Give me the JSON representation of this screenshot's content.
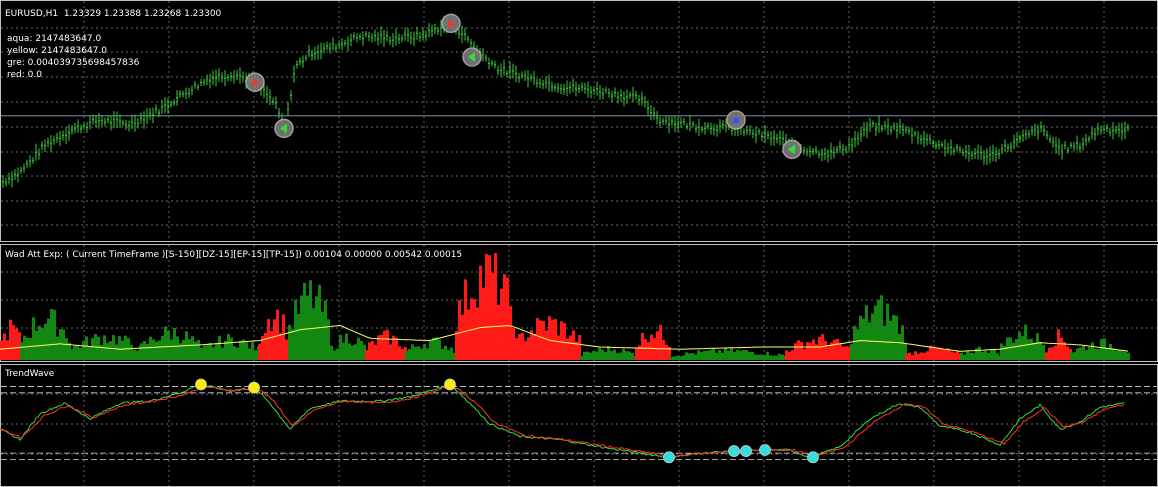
{
  "colors": {
    "background": "#000000",
    "grid": "#8a8a8a",
    "pane_border": "#c0c0c0",
    "candle": "#33cc33",
    "hline": "#9aa0c8",
    "hist_up": "#128712",
    "hist_down": "#ff1a1a",
    "signal_line": "#ffff66",
    "wave_green": "#33dd33",
    "wave_red": "#ff3030",
    "dot_yellow": "#ffee00",
    "dot_aqua": "#33dddd"
  },
  "main_pane": {
    "title": "EURUSD,H1  1.23329 1.23388 1.23268 1.23300",
    "info_lines": [
      "aqua: 2147483647.0",
      "yellow: 2147483647.0",
      "gre: 0.004039735698457836",
      "red: 0.0"
    ]
  },
  "wad_pane": {
    "title": "Wad Att Exp: ( Current TimeFrame )[S-150][DZ-15][EP-15][TP-15]) 0.00104 0.00000 0.00542 0.00015"
  },
  "wave_pane": {
    "title": "TrendWave"
  },
  "chart_data": [
    {
      "type": "candlestick",
      "symbol": "EURUSD",
      "timeframe": "H1",
      "title": "EURUSD,H1  1.23329 1.23388 1.23268 1.23300",
      "close_trace_normalized": [
        [
          0,
          0.2
        ],
        [
          20,
          0.25
        ],
        [
          45,
          0.38
        ],
        [
          70,
          0.45
        ],
        [
          100,
          0.5
        ],
        [
          130,
          0.48
        ],
        [
          160,
          0.55
        ],
        [
          185,
          0.63
        ],
        [
          210,
          0.7
        ],
        [
          235,
          0.72
        ],
        [
          255,
          0.68
        ],
        [
          275,
          0.58
        ],
        [
          285,
          0.45
        ],
        [
          295,
          0.75
        ],
        [
          310,
          0.82
        ],
        [
          340,
          0.86
        ],
        [
          360,
          0.9
        ],
        [
          390,
          0.89
        ],
        [
          420,
          0.9
        ],
        [
          450,
          0.96
        ],
        [
          465,
          0.9
        ],
        [
          480,
          0.82
        ],
        [
          500,
          0.74
        ],
        [
          530,
          0.7
        ],
        [
          560,
          0.66
        ],
        [
          600,
          0.64
        ],
        [
          640,
          0.6
        ],
        [
          660,
          0.5
        ],
        [
          700,
          0.47
        ],
        [
          735,
          0.46
        ],
        [
          760,
          0.43
        ],
        [
          785,
          0.4
        ],
        [
          805,
          0.36
        ],
        [
          830,
          0.34
        ],
        [
          850,
          0.38
        ],
        [
          870,
          0.47
        ],
        [
          900,
          0.46
        ],
        [
          930,
          0.4
        ],
        [
          960,
          0.35
        ],
        [
          990,
          0.33
        ],
        [
          1010,
          0.38
        ],
        [
          1040,
          0.46
        ],
        [
          1060,
          0.36
        ],
        [
          1080,
          0.38
        ],
        [
          1100,
          0.46
        ],
        [
          1130,
          0.45
        ]
      ],
      "signals": [
        {
          "x": 255,
          "y": 0.68,
          "dir": "up",
          "color": "#ff3030"
        },
        {
          "x": 284,
          "y": 0.46,
          "dir": "left",
          "color": "#33dd33"
        },
        {
          "x": 451,
          "y": 0.96,
          "dir": "up",
          "color": "#ff3030"
        },
        {
          "x": 472,
          "y": 0.8,
          "dir": "left",
          "color": "#33dd33"
        },
        {
          "x": 736,
          "y": 0.5,
          "dir": "up",
          "color": "#3050ff"
        },
        {
          "x": 792,
          "y": 0.36,
          "dir": "left",
          "color": "#33dd33"
        }
      ],
      "hline_level": 0.52
    },
    {
      "type": "bar",
      "title": "Wad Att Exp: ( Current TimeFrame )[S-150][DZ-15][EP-15][TP-15]) 0.00104 0.00000 0.00542 0.00015",
      "segments": [
        {
          "from": 0,
          "to": 20,
          "color": "down",
          "peak": 0.35
        },
        {
          "from": 20,
          "to": 70,
          "color": "up",
          "peak": 0.45
        },
        {
          "from": 70,
          "to": 140,
          "color": "up",
          "peak": 0.25
        },
        {
          "from": 140,
          "to": 200,
          "color": "up",
          "peak": 0.3
        },
        {
          "from": 200,
          "to": 258,
          "color": "up",
          "peak": 0.22
        },
        {
          "from": 258,
          "to": 288,
          "color": "down",
          "peak": 0.5
        },
        {
          "from": 288,
          "to": 330,
          "color": "up",
          "peak": 0.7
        },
        {
          "from": 330,
          "to": 365,
          "color": "up",
          "peak": 0.25
        },
        {
          "from": 365,
          "to": 405,
          "color": "down",
          "peak": 0.25
        },
        {
          "from": 405,
          "to": 455,
          "color": "up",
          "peak": 0.2
        },
        {
          "from": 455,
          "to": 515,
          "color": "down",
          "peak": 0.95
        },
        {
          "from": 515,
          "to": 580,
          "color": "down",
          "peak": 0.4
        },
        {
          "from": 580,
          "to": 635,
          "color": "up",
          "peak": 0.12
        },
        {
          "from": 635,
          "to": 670,
          "color": "down",
          "peak": 0.32
        },
        {
          "from": 670,
          "to": 785,
          "color": "up",
          "peak": 0.1
        },
        {
          "from": 785,
          "to": 850,
          "color": "down",
          "peak": 0.22
        },
        {
          "from": 850,
          "to": 905,
          "color": "up",
          "peak": 0.55
        },
        {
          "from": 905,
          "to": 960,
          "color": "down",
          "peak": 0.12
        },
        {
          "from": 960,
          "to": 1000,
          "color": "up",
          "peak": 0.12
        },
        {
          "from": 1000,
          "to": 1045,
          "color": "up",
          "peak": 0.3
        },
        {
          "from": 1045,
          "to": 1070,
          "color": "down",
          "peak": 0.25
        },
        {
          "from": 1070,
          "to": 1130,
          "color": "up",
          "peak": 0.18
        }
      ],
      "signal_trace_normalized": [
        [
          0,
          0.1
        ],
        [
          60,
          0.15
        ],
        [
          120,
          0.1
        ],
        [
          200,
          0.14
        ],
        [
          260,
          0.18
        ],
        [
          300,
          0.28
        ],
        [
          340,
          0.32
        ],
        [
          370,
          0.2
        ],
        [
          430,
          0.18
        ],
        [
          480,
          0.3
        ],
        [
          510,
          0.32
        ],
        [
          550,
          0.18
        ],
        [
          600,
          0.12
        ],
        [
          680,
          0.1
        ],
        [
          760,
          0.12
        ],
        [
          820,
          0.12
        ],
        [
          860,
          0.18
        ],
        [
          900,
          0.16
        ],
        [
          960,
          0.08
        ],
        [
          1000,
          0.1
        ],
        [
          1040,
          0.16
        ],
        [
          1080,
          0.14
        ],
        [
          1130,
          0.08
        ]
      ]
    },
    {
      "type": "line",
      "title": "TrendWave",
      "series": [
        {
          "color": "green",
          "trace_normalized": [
            [
              0,
              0.45
            ],
            [
              20,
              0.35
            ],
            [
              40,
              0.6
            ],
            [
              65,
              0.7
            ],
            [
              90,
              0.55
            ],
            [
              120,
              0.7
            ],
            [
              150,
              0.72
            ],
            [
              180,
              0.8
            ],
            [
              200,
              0.88
            ],
            [
              230,
              0.82
            ],
            [
              255,
              0.85
            ],
            [
              270,
              0.7
            ],
            [
              290,
              0.45
            ],
            [
              310,
              0.65
            ],
            [
              340,
              0.72
            ],
            [
              380,
              0.72
            ],
            [
              410,
              0.76
            ],
            [
              450,
              0.88
            ],
            [
              470,
              0.7
            ],
            [
              490,
              0.5
            ],
            [
              520,
              0.38
            ],
            [
              560,
              0.35
            ],
            [
              600,
              0.28
            ],
            [
              640,
              0.22
            ],
            [
              670,
              0.18
            ],
            [
              700,
              0.22
            ],
            [
              740,
              0.24
            ],
            [
              770,
              0.25
            ],
            [
              790,
              0.25
            ],
            [
              810,
              0.18
            ],
            [
              840,
              0.28
            ],
            [
              870,
              0.55
            ],
            [
              900,
              0.7
            ],
            [
              920,
              0.66
            ],
            [
              940,
              0.48
            ],
            [
              970,
              0.42
            ],
            [
              1000,
              0.3
            ],
            [
              1020,
              0.55
            ],
            [
              1040,
              0.68
            ],
            [
              1060,
              0.45
            ],
            [
              1080,
              0.52
            ],
            [
              1100,
              0.66
            ],
            [
              1125,
              0.7
            ]
          ]
        },
        {
          "color": "red",
          "trace_normalized": [
            [
              0,
              0.45
            ],
            [
              22,
              0.37
            ],
            [
              44,
              0.58
            ],
            [
              68,
              0.68
            ],
            [
              93,
              0.56
            ],
            [
              123,
              0.68
            ],
            [
              153,
              0.72
            ],
            [
              183,
              0.78
            ],
            [
              203,
              0.86
            ],
            [
              233,
              0.82
            ],
            [
              258,
              0.84
            ],
            [
              274,
              0.72
            ],
            [
              293,
              0.47
            ],
            [
              313,
              0.63
            ],
            [
              343,
              0.72
            ],
            [
              383,
              0.7
            ],
            [
              413,
              0.75
            ],
            [
              453,
              0.87
            ],
            [
              474,
              0.72
            ],
            [
              494,
              0.52
            ],
            [
              524,
              0.39
            ],
            [
              564,
              0.35
            ],
            [
              604,
              0.29
            ],
            [
              644,
              0.23
            ],
            [
              674,
              0.19
            ],
            [
              704,
              0.22
            ],
            [
              744,
              0.24
            ],
            [
              774,
              0.25
            ],
            [
              794,
              0.25
            ],
            [
              814,
              0.19
            ],
            [
              844,
              0.27
            ],
            [
              874,
              0.52
            ],
            [
              904,
              0.69
            ],
            [
              924,
              0.66
            ],
            [
              944,
              0.5
            ],
            [
              974,
              0.42
            ],
            [
              1004,
              0.31
            ],
            [
              1024,
              0.52
            ],
            [
              1044,
              0.66
            ],
            [
              1064,
              0.47
            ],
            [
              1084,
              0.52
            ],
            [
              1104,
              0.64
            ],
            [
              1125,
              0.69
            ]
          ]
        }
      ],
      "levels": [
        0.86,
        0.8,
        0.22,
        0.16
      ],
      "dots": [
        {
          "x": 201,
          "y": 0.88,
          "color": "yellow"
        },
        {
          "x": 254,
          "y": 0.85,
          "color": "yellow"
        },
        {
          "x": 450,
          "y": 0.88,
          "color": "yellow"
        },
        {
          "x": 669,
          "y": 0.18,
          "color": "aqua"
        },
        {
          "x": 734,
          "y": 0.24,
          "color": "aqua"
        },
        {
          "x": 746,
          "y": 0.24,
          "color": "aqua"
        },
        {
          "x": 765,
          "y": 0.25,
          "color": "aqua"
        },
        {
          "x": 813,
          "y": 0.18,
          "color": "aqua"
        }
      ]
    }
  ]
}
